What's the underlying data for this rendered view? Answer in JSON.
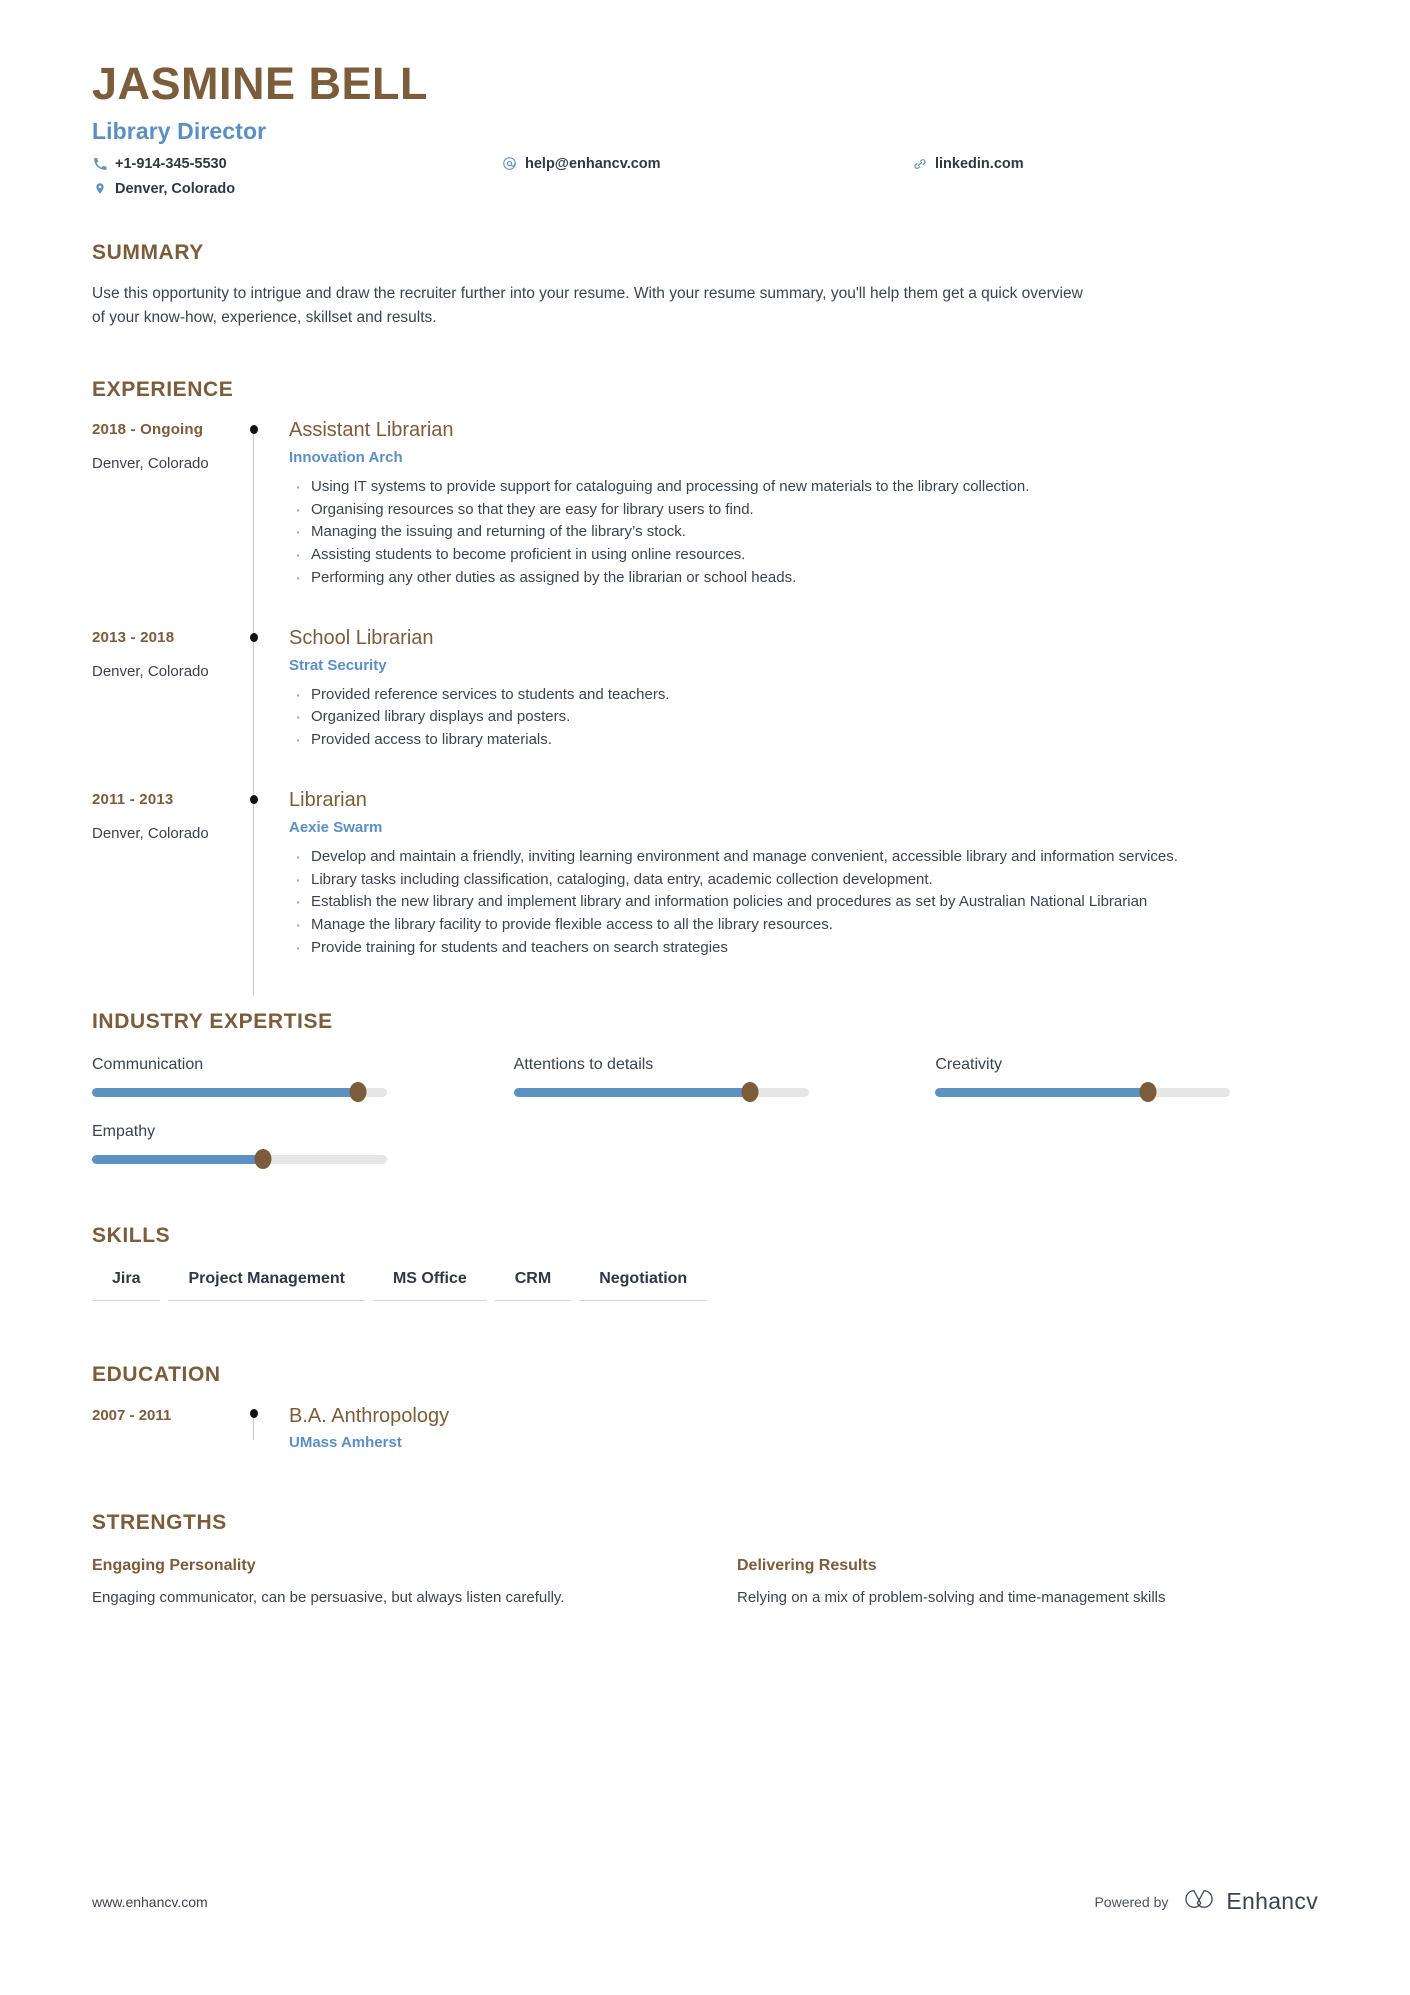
{
  "header": {
    "name": "JASMINE BELL",
    "job_title": "Library Director",
    "contacts": [
      {
        "icon": "phone-icon",
        "value": "+1-914-345-5530"
      },
      {
        "icon": "email-icon",
        "value": "help@enhancv.com"
      },
      {
        "icon": "link-icon",
        "value": "linkedin.com"
      },
      {
        "icon": "location-icon",
        "value": "Denver, Colorado"
      }
    ]
  },
  "summary": {
    "title": "SUMMARY",
    "text": "Use this opportunity to intrigue and draw the recruiter further into your resume. With your resume summary, you'll help them get a quick overview of your know-how, experience, skillset and results."
  },
  "experience": {
    "title": "EXPERIENCE",
    "entries": [
      {
        "date": "2018 - Ongoing",
        "location": "Denver, Colorado",
        "role": "Assistant Librarian",
        "company": "Innovation Arch",
        "bullets": [
          "Using IT systems to provide support for cataloguing and processing of new  materials to the library collection.",
          "Organising resources so that they are easy for library users to find.",
          "Managing the issuing and returning of the library’s stock.",
          "Assisting students to become proficient in using online resources.",
          "Performing any other duties as assigned by the librarian or school heads."
        ]
      },
      {
        "date": "2013 - 2018",
        "location": "Denver, Colorado",
        "role": "School Librarian",
        "company": "Strat Security",
        "bullets": [
          "Provided reference services to students and teachers.",
          "Organized library displays and posters.",
          "Provided access to library materials."
        ]
      },
      {
        "date": "2011 - 2013",
        "location": "Denver, Colorado",
        "role": "Librarian",
        "company": "Aexie Swarm",
        "bullets": [
          "Develop and maintain a friendly, inviting learning environment and manage convenient, accessible library and information services.",
          "Library tasks including classification, cataloging, data entry, academic collection development.",
          "Establish the new library and implement library and information policies and procedures as set by Australian National Librarian",
          "Manage the library facility to provide flexible access to all the library resources.",
          "Provide training for students and teachers on search strategies"
        ]
      }
    ]
  },
  "expertise": {
    "title": "INDUSTRY EXPERTISE",
    "items": [
      {
        "label": "Communication",
        "value": 90
      },
      {
        "label": "Attentions to details",
        "value": 80
      },
      {
        "label": "Creativity",
        "value": 72
      },
      {
        "label": "Empathy",
        "value": 58
      }
    ]
  },
  "skills": {
    "title": "SKILLS",
    "items": [
      "Jira",
      "Project Management",
      "MS Office",
      "CRM",
      "Negotiation"
    ]
  },
  "education": {
    "title": "EDUCATION",
    "entries": [
      {
        "date": "2007 - 2011",
        "degree": "B.A. Anthropology",
        "school": "UMass Amherst"
      }
    ]
  },
  "strengths": {
    "title": "STRENGTHS",
    "items": [
      {
        "title": "Engaging Personality",
        "description": "Engaging communicator, can be persuasive, but always listen carefully."
      },
      {
        "title": "Delivering Results",
        "description": "Relying on a mix of problem-solving and time-management skills"
      }
    ]
  },
  "footer": {
    "url": "www.enhancv.com",
    "powered_by": "Powered by",
    "brand": "Enhancv"
  },
  "colors": {
    "brown": "#7b5c3b",
    "blue": "#5b8fc4",
    "slider_fill": "#5b92c2",
    "slider_track": "#e6e6e6",
    "text": "#3b4351"
  }
}
